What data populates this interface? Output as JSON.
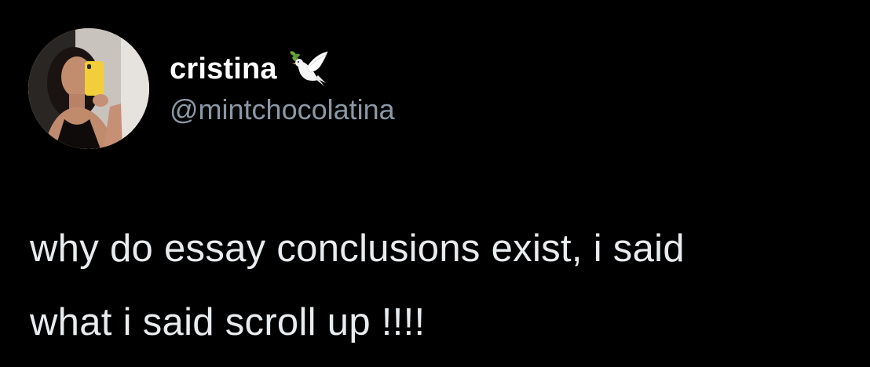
{
  "user": {
    "display_name": "cristina",
    "handle": "@mintchocolatina",
    "badge_icon": "dove-icon",
    "avatar_icon": "avatar"
  },
  "tweet": {
    "lines": [
      "why do essay conclusions exist, i said",
      "what i said scroll up !!!!"
    ]
  },
  "colors": {
    "background": "#000000",
    "name": "#ffffff",
    "handle": "#8b98a5",
    "text": "#e9ecef"
  }
}
